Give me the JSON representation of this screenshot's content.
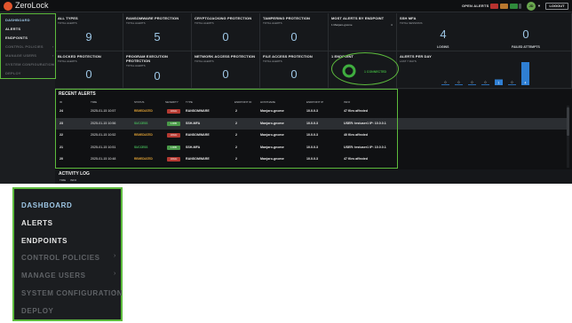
{
  "app": {
    "name": "ZeroLock"
  },
  "topbar": {
    "open_alerts_label": "OPEN ALERTS",
    "avatar_initials": "JD",
    "logout_label": "LOGOUT"
  },
  "sidebar": {
    "items": [
      {
        "label": "DASHBOARD",
        "state": "active"
      },
      {
        "label": "ALERTS",
        "state": "normal"
      },
      {
        "label": "ENDPOINTS",
        "state": "normal"
      },
      {
        "label": "CONTROL POLICIES",
        "state": "disabled",
        "has_submenu": true
      },
      {
        "label": "MANAGE USERS",
        "state": "disabled",
        "has_submenu": true
      },
      {
        "label": "SYSTEM CONFIGURATION",
        "state": "disabled",
        "has_submenu": true
      },
      {
        "label": "DEPLOY",
        "state": "disabled"
      }
    ]
  },
  "cards": {
    "all_types": {
      "title": "ALL TYPES",
      "sub": "TOTAL ALERTS",
      "value": "9"
    },
    "ransomware": {
      "title": "RANSOMWARE PROTECTION",
      "sub": "TOTAL ALERTS",
      "value": "5"
    },
    "cryptojacking": {
      "title": "CRYPTOJACKING PROTECTION",
      "sub": "TOTAL ALERTS",
      "value": "0"
    },
    "tampering": {
      "title": "TAMPERING PROTECTION",
      "sub": "TOTAL ALERTS",
      "value": "0"
    },
    "most_alerts": {
      "title": "MOST ALERTS BY ENDPOINT",
      "item_name": "1 Manjaro-gnome",
      "item_count": "4"
    },
    "ssh_mfa": {
      "title": "SSH MFA",
      "sub": "TOTAL SESSIONS",
      "logins_value": "4",
      "logins_label": "LOGINS",
      "failed_value": "0",
      "failed_label": "FAILED ATTEMPTS"
    },
    "blocked": {
      "title": "BLOCKED PROTECTION",
      "sub": "TOTAL ALERTS",
      "value": "0"
    },
    "program_exec": {
      "title": "PROGRAM EXECUTION PROTECTION",
      "sub": "TOTAL ALERTS",
      "value": "0"
    },
    "network_access": {
      "title": "NETWORK ACCESS PROTECTION",
      "sub": "TOTAL ALERTS",
      "value": "0"
    },
    "file_access": {
      "title": "FILE ACCESS PROTECTION",
      "sub": "TOTAL ALERTS",
      "value": "0"
    },
    "endpoint": {
      "title": "1 ENDPOINT",
      "connected_label": "1 CONNECTED"
    },
    "alerts_per_day": {
      "title": "ALERTS PER DAY",
      "sub": "LAST 7 DAYS"
    }
  },
  "chart_data": {
    "type": "bar",
    "title": "ALERTS PER DAY",
    "subtitle": "LAST 7 DAYS",
    "categories": [
      "",
      "",
      "",
      "",
      "",
      "",
      ""
    ],
    "values": [
      0,
      0,
      0,
      0,
      1,
      0,
      4
    ],
    "data_labels": [
      "0",
      "0",
      "0",
      "0",
      "1",
      "0",
      "4"
    ],
    "grid": false,
    "legend": "none",
    "color": "#2f7fd3"
  },
  "recent_alerts": {
    "title": "RECENT ALERTS",
    "columns": [
      "ID",
      "TIME",
      "STATUS",
      "SEVERITY",
      "TYPE",
      "ENDPOINT ID",
      "HOSTNAME",
      "ENDPOINT IP",
      "INFO"
    ],
    "rows": [
      {
        "id": "24",
        "time": "2025-01-15 10:57",
        "status": "REMEDIATED",
        "status_kind": "rem",
        "severity": "HIGH",
        "sev_kind": "high",
        "type": "RANSOMWARE",
        "endpoint_id": "2",
        "hostname": "Manjaro-gnome",
        "ip": "10.0.0.3",
        "info": "47 files affected",
        "highlight": false
      },
      {
        "id": "23",
        "time": "2025-01-15 10:56",
        "status": "SUCCESS",
        "status_kind": "suc",
        "severity": "LOW",
        "sev_kind": "low",
        "type": "SSH-MFA",
        "endpoint_id": "2",
        "hostname": "Manjaro-gnome",
        "ip": "10.0.0.3",
        "info": "USER: testuser1 IP: 10.0.0.1",
        "highlight": true
      },
      {
        "id": "22",
        "time": "2025-01-15 10:52",
        "status": "REMEDIATED",
        "status_kind": "rem",
        "severity": "HIGH",
        "sev_kind": "high",
        "type": "RANSOMWARE",
        "endpoint_id": "2",
        "hostname": "Manjaro-gnome",
        "ip": "10.0.0.3",
        "info": "40 files affected",
        "highlight": false
      },
      {
        "id": "21",
        "time": "2025-01-15 10:51",
        "status": "SUCCESS",
        "status_kind": "suc",
        "severity": "LOW",
        "sev_kind": "low",
        "type": "SSH-MFA",
        "endpoint_id": "2",
        "hostname": "Manjaro-gnome",
        "ip": "10.0.0.3",
        "info": "USER: testuser1 IP: 10.0.0.1",
        "highlight": false
      },
      {
        "id": "20",
        "time": "2025-01-15 10:48",
        "status": "REMEDIATED",
        "status_kind": "rem",
        "severity": "HIGH",
        "sev_kind": "high",
        "type": "RANSOMWARE",
        "endpoint_id": "2",
        "hostname": "Manjaro-gnome",
        "ip": "10.0.0.3",
        "info": "47 files affected",
        "highlight": false
      }
    ]
  },
  "activity_log": {
    "title": "ACTIVITY LOG",
    "columns": [
      "TIME",
      "INFO"
    ]
  },
  "colors": {
    "accent": "#5dbb3d",
    "active_nav": "#9ec7e6",
    "value": "#9ec7e6",
    "remediated": "#e0a235",
    "success": "#46b95a"
  }
}
